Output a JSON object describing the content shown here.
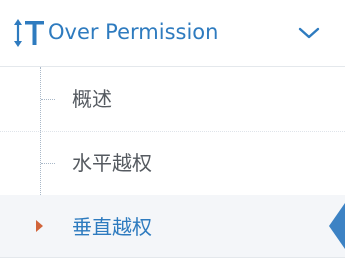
{
  "menu": {
    "title": "Over Permission",
    "icon": "text-height-icon",
    "expanded": true,
    "accent_color": "#2e7bbf",
    "items": [
      {
        "label": "概述",
        "active": false
      },
      {
        "label": "水平越权",
        "active": false
      },
      {
        "label": "垂直越权",
        "active": true
      }
    ],
    "active_caret_color": "#d1643a",
    "active_pointer_color": "#3c82c4"
  }
}
